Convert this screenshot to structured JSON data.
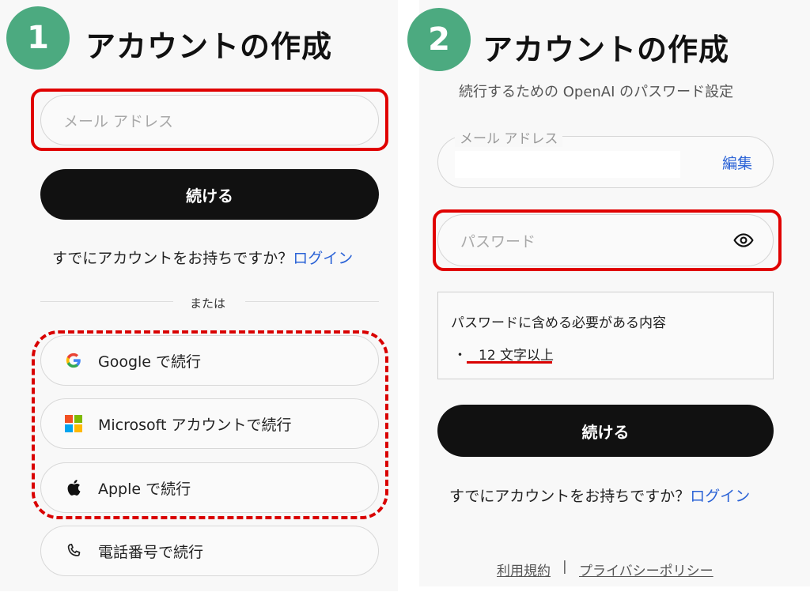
{
  "panel1": {
    "step": "1",
    "title": "アカウントの作成",
    "email_placeholder": "メール アドレス",
    "continue_label": "続ける",
    "have_account": "すでにアカウントをお持ちですか？",
    "login_link": "ログイン",
    "divider": "または",
    "google_label": "Google で続行",
    "microsoft_label": "Microsoft アカウントで続行",
    "apple_label": "Apple で続行",
    "phone_label": "電話番号で続行"
  },
  "panel2": {
    "step": "2",
    "title": "アカウントの作成",
    "subtitle": "続行するための OpenAI のパスワード設定",
    "email_label": "メール アドレス",
    "edit_link": "編集",
    "password_placeholder": "パスワード",
    "requirements_title": "パスワードに含める必要がある内容",
    "requirement_bullet": "・",
    "requirement_1": "12 文字以上",
    "continue_label": "続ける",
    "have_account": "すでにアカウントをお持ちですか？",
    "login_link": "ログイン",
    "terms_link": "利用規約",
    "separator": "|",
    "privacy_link": "プライバシーポリシー"
  },
  "colors": {
    "badge": "#4caa80",
    "highlight": "#e00000",
    "link": "#2a62d6",
    "button": "#111111"
  },
  "icons": [
    "google-icon",
    "microsoft-icon",
    "apple-icon",
    "phone-icon",
    "eye-icon"
  ]
}
